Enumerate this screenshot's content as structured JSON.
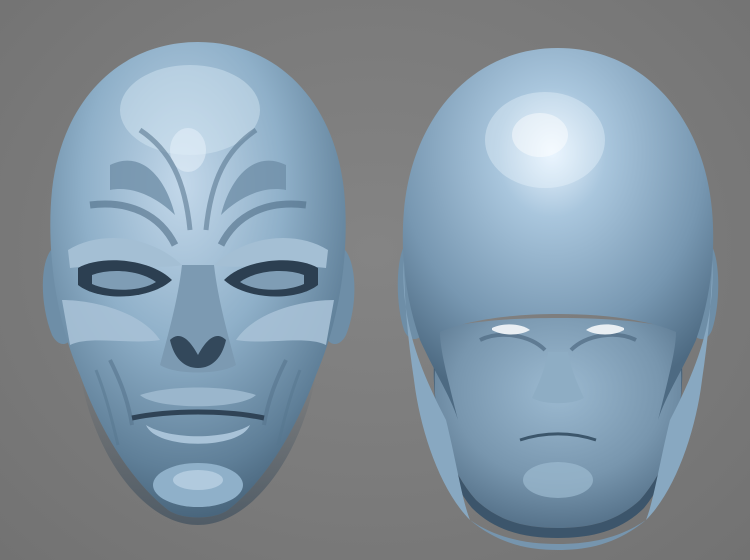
{
  "scene": {
    "background_color": "#7b7b7b",
    "material_color": "#8fb0c9",
    "objects": [
      {
        "name": "skull-mask",
        "icon": "skull-mask-render"
      },
      {
        "name": "hood-mask",
        "icon": "hood-mask-render"
      }
    ]
  }
}
